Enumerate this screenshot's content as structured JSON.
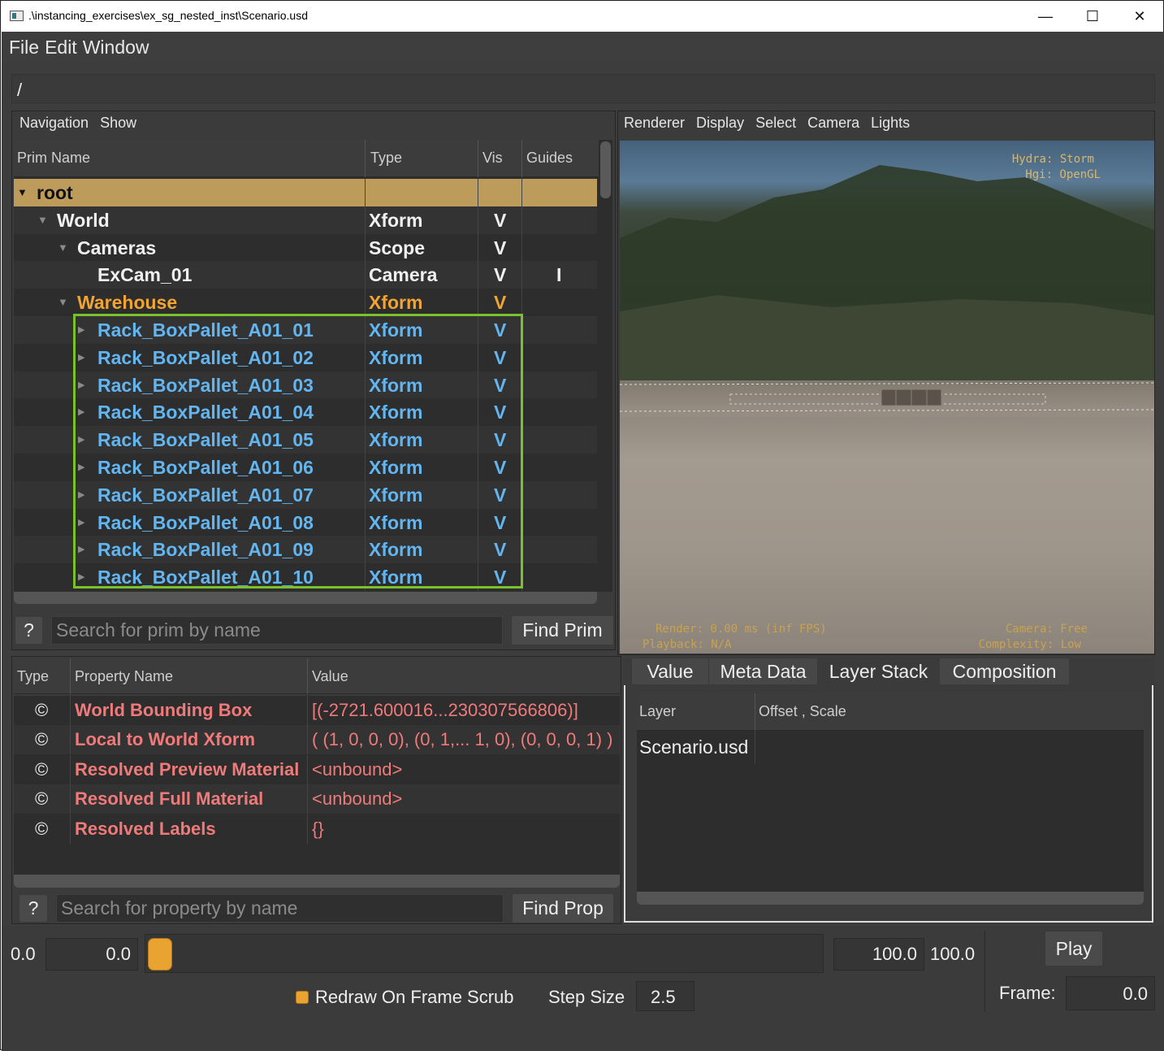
{
  "window": {
    "title": ".\\instancing_exercises\\ex_sg_nested_inst\\Scenario.usd",
    "min": "—",
    "max": "☐",
    "close": "✕"
  },
  "menubar": {
    "items": [
      "File",
      "Edit",
      "Window"
    ]
  },
  "path": "/",
  "tree": {
    "menu": [
      "Navigation",
      "Show"
    ],
    "columns": {
      "name": "Prim Name",
      "type": "Type",
      "vis": "Vis",
      "guides": "Guides"
    },
    "rows": [
      {
        "name": "root",
        "type": "",
        "vis": "",
        "guides": "",
        "expanded": true
      },
      {
        "name": "World",
        "type": "Xform",
        "vis": "V",
        "guides": "",
        "expanded": true
      },
      {
        "name": "Cameras",
        "type": "Scope",
        "vis": "V",
        "guides": "",
        "expanded": true
      },
      {
        "name": "ExCam_01",
        "type": "Camera",
        "vis": "V",
        "guides": "I"
      },
      {
        "name": "Warehouse",
        "type": "Xform",
        "vis": "V",
        "guides": "",
        "expanded": true
      },
      {
        "name": "Rack_BoxPallet_A01_01",
        "type": "Xform",
        "vis": "V",
        "guides": ""
      },
      {
        "name": "Rack_BoxPallet_A01_02",
        "type": "Xform",
        "vis": "V",
        "guides": ""
      },
      {
        "name": "Rack_BoxPallet_A01_03",
        "type": "Xform",
        "vis": "V",
        "guides": ""
      },
      {
        "name": "Rack_BoxPallet_A01_04",
        "type": "Xform",
        "vis": "V",
        "guides": ""
      },
      {
        "name": "Rack_BoxPallet_A01_05",
        "type": "Xform",
        "vis": "V",
        "guides": ""
      },
      {
        "name": "Rack_BoxPallet_A01_06",
        "type": "Xform",
        "vis": "V",
        "guides": ""
      },
      {
        "name": "Rack_BoxPallet_A01_07",
        "type": "Xform",
        "vis": "V",
        "guides": ""
      },
      {
        "name": "Rack_BoxPallet_A01_08",
        "type": "Xform",
        "vis": "V",
        "guides": ""
      },
      {
        "name": "Rack_BoxPallet_A01_09",
        "type": "Xform",
        "vis": "V",
        "guides": ""
      },
      {
        "name": "Rack_BoxPallet_A01_10",
        "type": "Xform",
        "vis": "V",
        "guides": ""
      }
    ],
    "help": "?",
    "search_placeholder": "Search for prim by name",
    "find": "Find Prim"
  },
  "viewport": {
    "menu": [
      "Renderer",
      "Display",
      "Select",
      "Camera",
      "Lights"
    ],
    "hud": {
      "hydra": "Hydra: Storm",
      "hgi": "Hgi: OpenGL",
      "render": "Render: 0.00 ms (inf FPS)",
      "playback": "Playback: N/A",
      "camera": "Camera: Free",
      "complexity": "Complexity: Low"
    }
  },
  "props": {
    "columns": {
      "type": "Type",
      "name": "Property Name",
      "value": "Value"
    },
    "rows": [
      {
        "icon": "©",
        "name": "World Bounding Box",
        "value": "[(-2721.600016...230307566806)]"
      },
      {
        "icon": "©",
        "name": "Local to World Xform",
        "value": "( (1, 0, 0, 0), (0, 1,... 1, 0), (0, 0, 0, 1) )"
      },
      {
        "icon": "©",
        "name": "Resolved Preview Material",
        "value": "<unbound>"
      },
      {
        "icon": "©",
        "name": "Resolved Full Material",
        "value": "<unbound>"
      },
      {
        "icon": "©",
        "name": "Resolved Labels",
        "value": "{}"
      }
    ],
    "help": "?",
    "search_placeholder": "Search for property by name",
    "find": "Find Prop"
  },
  "inspector": {
    "tabs": [
      "Value",
      "Meta Data",
      "Layer Stack",
      "Composition"
    ],
    "active_tab": "Layer Stack",
    "columns": {
      "layer": "Layer",
      "offset": "Offset , Scale"
    },
    "rows": [
      {
        "layer": "Scenario.usd",
        "offset": ""
      }
    ]
  },
  "timeline": {
    "start_label": "0.0",
    "start_value": "0.0",
    "end_value": "100.0",
    "end_label": "100.0",
    "play": "Play",
    "redraw": "Redraw On Frame Scrub",
    "step_label": "Step Size",
    "step_value": "2.5",
    "frame_label": "Frame:",
    "frame_value": "0.0"
  },
  "colors": {
    "selected_row": "#bd9b5a",
    "instance_blue": "#63b5f0",
    "warehouse_orange": "#f0a433",
    "prop_red": "#f07a7a",
    "highlight_box": "#7ac12c"
  }
}
